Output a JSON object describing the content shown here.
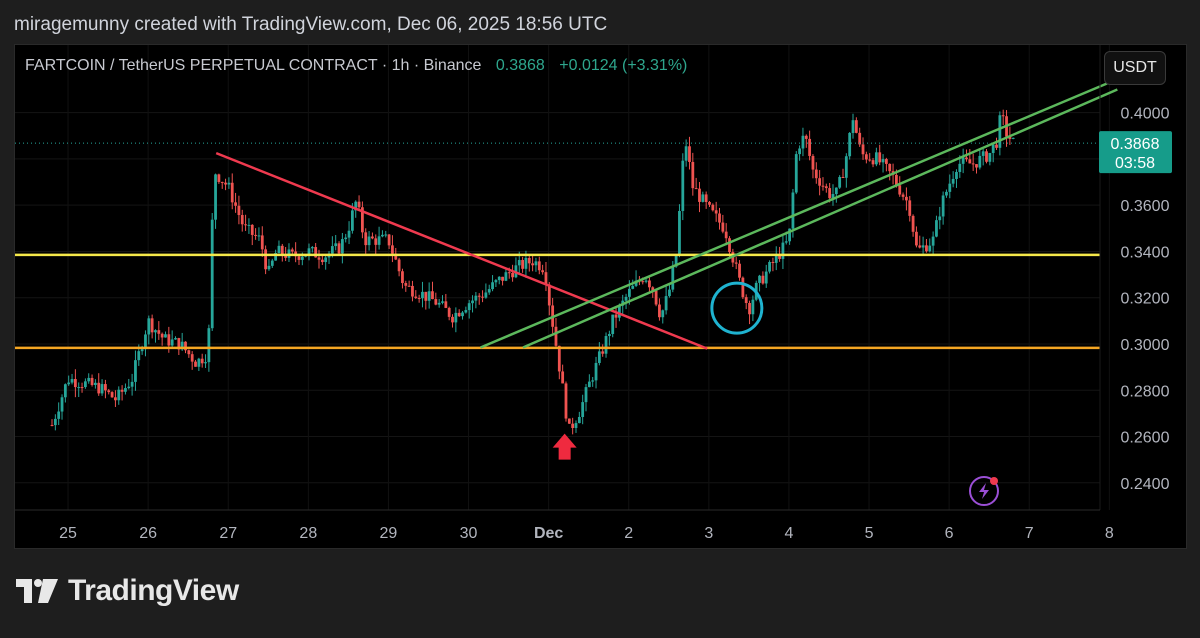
{
  "header": {
    "credit": "miragemunny created with TradingView.com, Dec 06, 2025 18:56 UTC"
  },
  "legend": {
    "symbol": "FARTCOIN / TetherUS PERPETUAL CONTRACT · 1h · Binance",
    "price": "0.3868",
    "change": "+0.0124 (+3.31%)"
  },
  "currency_button": "USDT",
  "price_tag": {
    "price": "0.3868",
    "countdown": "03:58"
  },
  "footer": {
    "brand": "TradingView"
  },
  "colors": {
    "up": "#26a69a",
    "down": "#ef5350",
    "yellow_line": "#f5e84a",
    "orange_line": "#f5a623",
    "green_line": "#5cb85c",
    "red_line": "#ef3a4f",
    "circle": "#1fb3d0"
  },
  "chart_data": {
    "type": "candlestick",
    "timeframe": "1h",
    "x_labels": [
      "25",
      "26",
      "27",
      "28",
      "29",
      "30",
      "Dec",
      "2",
      "3",
      "4",
      "5",
      "6",
      "7",
      "8"
    ],
    "y_ticks": [
      "0.4000",
      "0.3800",
      "0.3600",
      "0.3400",
      "0.3200",
      "0.3000",
      "0.2800",
      "0.2600",
      "0.2400"
    ],
    "ylim": [
      0.233,
      0.418
    ],
    "last_price": 0.3868,
    "path": [
      [
        24.8,
        0.265
      ],
      [
        25.0,
        0.285
      ],
      [
        25.2,
        0.283
      ],
      [
        25.4,
        0.281
      ],
      [
        25.6,
        0.276
      ],
      [
        25.8,
        0.285
      ],
      [
        26.0,
        0.31
      ],
      [
        26.2,
        0.302
      ],
      [
        26.4,
        0.3
      ],
      [
        26.6,
        0.292
      ],
      [
        26.75,
        0.296
      ],
      [
        26.82,
        0.375
      ],
      [
        27.0,
        0.368
      ],
      [
        27.2,
        0.35
      ],
      [
        27.4,
        0.345
      ],
      [
        27.5,
        0.33
      ],
      [
        27.6,
        0.34
      ],
      [
        27.8,
        0.338
      ],
      [
        28.0,
        0.34
      ],
      [
        28.2,
        0.338
      ],
      [
        28.4,
        0.342
      ],
      [
        28.5,
        0.35
      ],
      [
        28.6,
        0.362
      ],
      [
        28.7,
        0.345
      ],
      [
        28.9,
        0.345
      ],
      [
        29.0,
        0.345
      ],
      [
        29.2,
        0.325
      ],
      [
        29.4,
        0.322
      ],
      [
        29.6,
        0.318
      ],
      [
        29.8,
        0.312
      ],
      [
        30.0,
        0.318
      ],
      [
        30.2,
        0.322
      ],
      [
        30.4,
        0.328
      ],
      [
        30.6,
        0.333
      ],
      [
        30.8,
        0.336
      ],
      [
        30.95,
        0.333
      ],
      [
        31.0,
        0.32
      ],
      [
        31.1,
        0.298
      ],
      [
        31.2,
        0.275
      ],
      [
        31.25,
        0.262
      ],
      [
        31.4,
        0.272
      ],
      [
        31.5,
        0.282
      ],
      [
        31.7,
        0.3
      ],
      [
        31.8,
        0.31
      ],
      [
        32.0,
        0.322
      ],
      [
        32.2,
        0.33
      ],
      [
        32.3,
        0.324
      ],
      [
        32.4,
        0.312
      ],
      [
        32.5,
        0.322
      ],
      [
        32.6,
        0.34
      ],
      [
        32.7,
        0.39
      ],
      [
        32.8,
        0.368
      ],
      [
        33.0,
        0.358
      ],
      [
        33.2,
        0.35
      ],
      [
        33.4,
        0.325
      ],
      [
        33.5,
        0.315
      ],
      [
        33.6,
        0.325
      ],
      [
        33.8,
        0.335
      ],
      [
        34.0,
        0.345
      ],
      [
        34.1,
        0.385
      ],
      [
        34.2,
        0.39
      ],
      [
        34.3,
        0.375
      ],
      [
        34.5,
        0.365
      ],
      [
        34.6,
        0.365
      ],
      [
        34.7,
        0.378
      ],
      [
        34.8,
        0.398
      ],
      [
        34.9,
        0.382
      ],
      [
        35.1,
        0.38
      ],
      [
        35.3,
        0.372
      ],
      [
        35.5,
        0.36
      ],
      [
        35.6,
        0.34
      ],
      [
        35.8,
        0.345
      ],
      [
        35.9,
        0.36
      ],
      [
        36.1,
        0.378
      ],
      [
        36.3,
        0.378
      ],
      [
        36.5,
        0.382
      ],
      [
        36.6,
        0.388
      ],
      [
        36.65,
        0.4
      ],
      [
        36.7,
        0.392
      ],
      [
        36.8,
        0.387
      ]
    ],
    "annotations": [
      {
        "type": "horizontal",
        "name": "yellow",
        "y": 0.3385
      },
      {
        "type": "horizontal",
        "name": "orange",
        "y": 0.2983
      },
      {
        "type": "trendline",
        "name": "red",
        "x1": 26.85,
        "y1": 0.3825,
        "x2": 32.98,
        "y2": 0.298
      },
      {
        "type": "trendline",
        "name": "green-upper",
        "x1": 30.15,
        "y1": 0.2985,
        "x2": 38.1,
        "y2": 0.4145
      },
      {
        "type": "trendline",
        "name": "green-lower",
        "x1": 30.68,
        "y1": 0.2985,
        "x2": 38.1,
        "y2": 0.41
      },
      {
        "type": "circle",
        "x": 33.35,
        "y": 0.3155
      },
      {
        "type": "arrow-up",
        "x": 31.2,
        "y": 0.25
      }
    ]
  }
}
